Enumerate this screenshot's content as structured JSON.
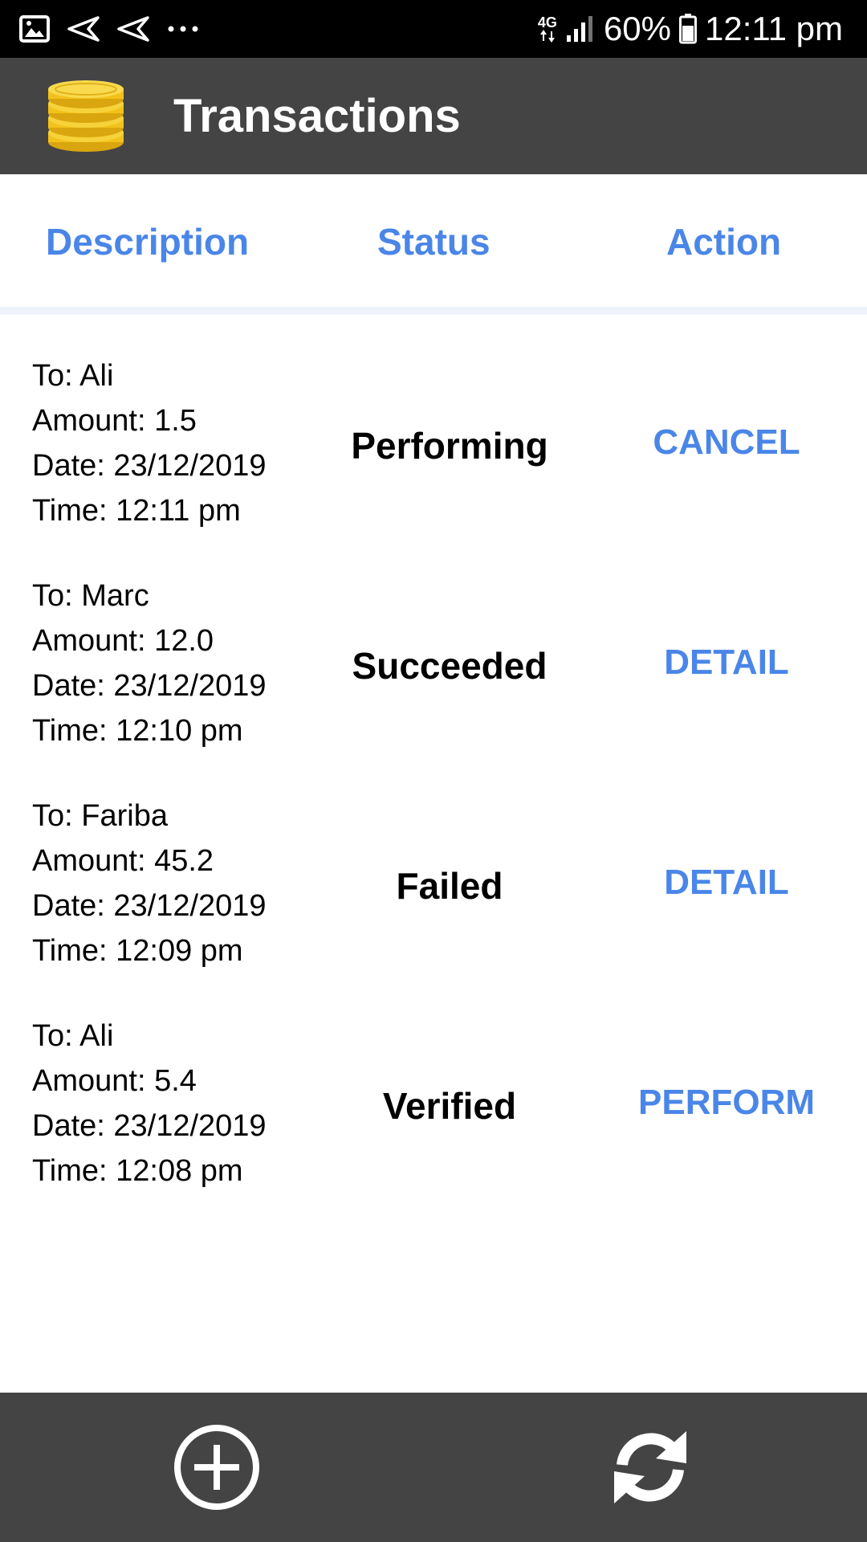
{
  "status_bar": {
    "network": "4G",
    "battery": "60%",
    "time": "12:11 pm",
    "icons": [
      "image-icon",
      "send-icon",
      "send-icon",
      "more-dots-icon",
      "signal-icon",
      "battery-icon"
    ]
  },
  "toolbar": {
    "title": "Transactions",
    "logo": "coins-icon"
  },
  "columns": {
    "description": "Description",
    "status": "Status",
    "action": "Action"
  },
  "transactions": [
    {
      "to": "To: Ali",
      "amount": "Amount: 1.5",
      "date": "Date: 23/12/2019",
      "time": "Time: 12:11 pm",
      "status": "Performing",
      "action": "CANCEL"
    },
    {
      "to": "To: Marc",
      "amount": "Amount: 12.0",
      "date": "Date: 23/12/2019",
      "time": "Time: 12:10 pm",
      "status": "Succeeded",
      "action": "DETAIL"
    },
    {
      "to": "To: Fariba",
      "amount": "Amount: 45.2",
      "date": "Date: 23/12/2019",
      "time": "Time: 12:09 pm",
      "status": "Failed",
      "action": "DETAIL"
    },
    {
      "to": "To: Ali",
      "amount": "Amount: 5.4",
      "date": "Date: 23/12/2019",
      "time": "Time: 12:08 pm",
      "status": "Verified",
      "action": "PERFORM"
    }
  ],
  "bottom_bar": {
    "add_icon": "add-circle-icon",
    "refresh_icon": "refresh-icon"
  },
  "colors": {
    "accent": "#4a86e8",
    "toolbar": "#444444",
    "status_bar": "#000000",
    "coin": "#f2c21b"
  }
}
